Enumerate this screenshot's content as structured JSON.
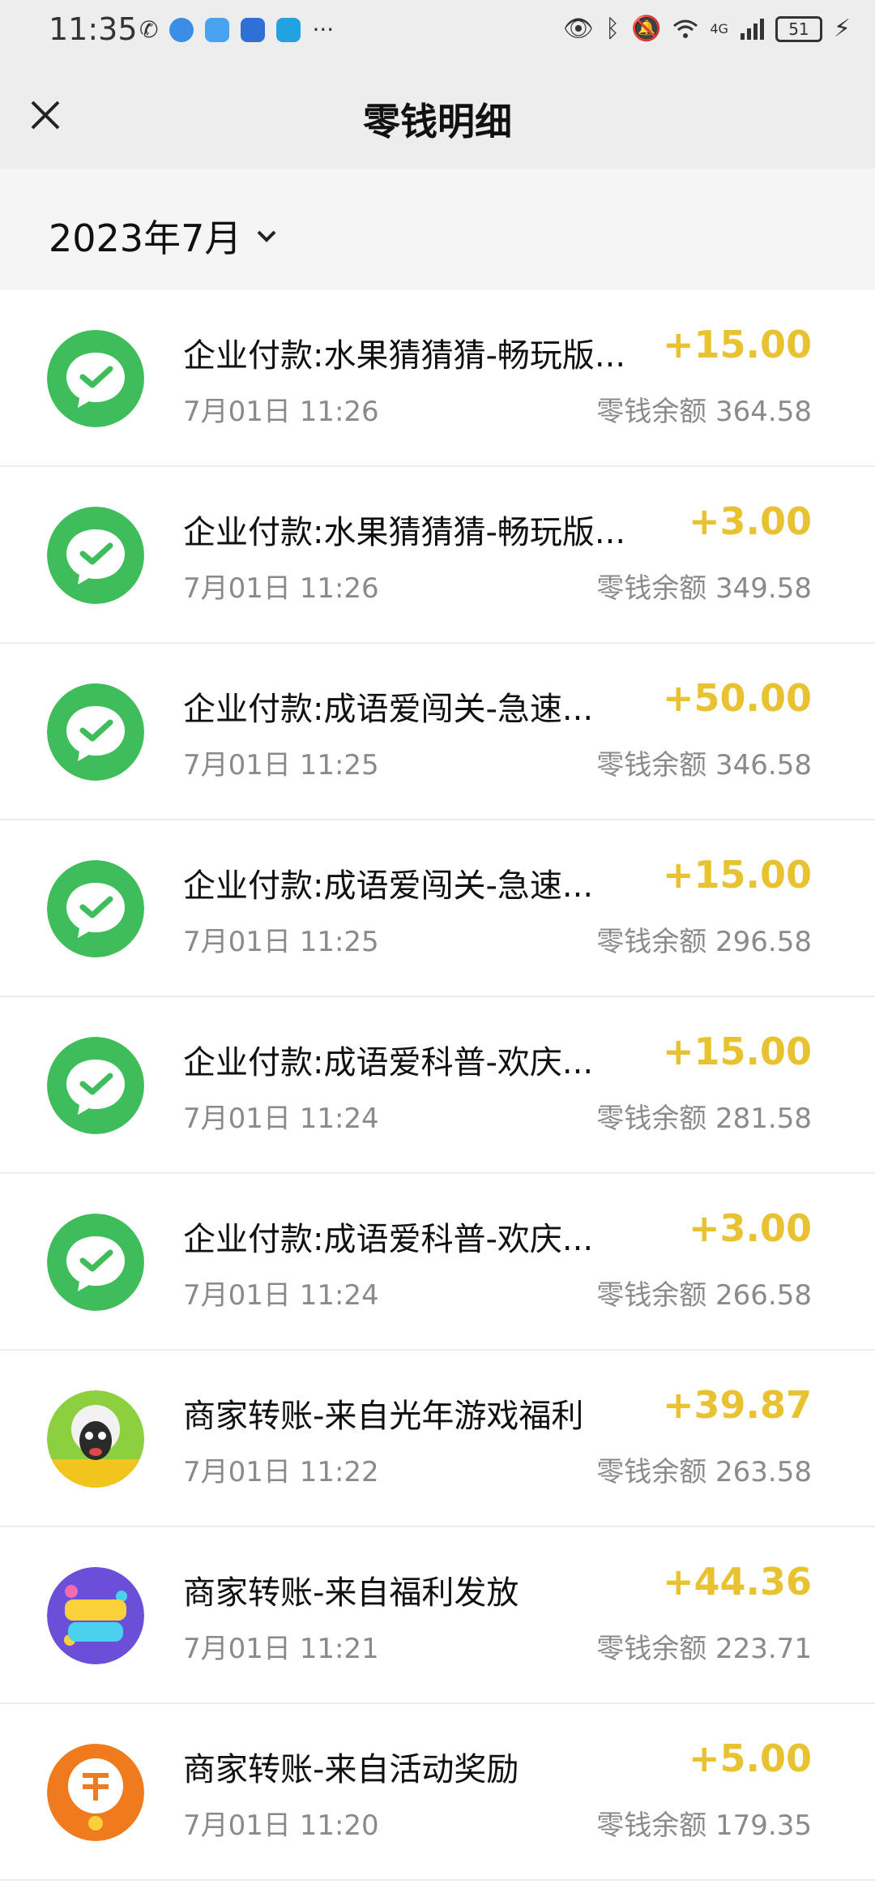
{
  "status": {
    "time": "11:35",
    "battery": "51",
    "network": "4G"
  },
  "header": {
    "title": "零钱明细",
    "close_icon": "close-icon"
  },
  "month": {
    "label": "2023年7月",
    "icon": "chevron-down-icon"
  },
  "balance_label": "零钱余额",
  "colors": {
    "amount": "#e8c230",
    "wechat_green": "#3ebd5a",
    "header_bg": "#ededed"
  },
  "transactions": [
    {
      "title": "企业付款:水果猜猜猜-畅玩版...",
      "time": "7月01日 11:26",
      "amount": "+15.00",
      "balance": "零钱余额 364.58",
      "icon": "wechat-pay-icon"
    },
    {
      "title": "企业付款:水果猜猜猜-畅玩版...",
      "time": "7月01日 11:26",
      "amount": "+3.00",
      "balance": "零钱余额 349.58",
      "icon": "wechat-pay-icon"
    },
    {
      "title": "企业付款:成语爱闯关-急速...",
      "time": "7月01日 11:25",
      "amount": "+50.00",
      "balance": "零钱余额 346.58",
      "icon": "wechat-pay-icon"
    },
    {
      "title": "企业付款:成语爱闯关-急速...",
      "time": "7月01日 11:25",
      "amount": "+15.00",
      "balance": "零钱余额 296.58",
      "icon": "wechat-pay-icon"
    },
    {
      "title": "企业付款:成语爱科普-欢庆...",
      "time": "7月01日 11:24",
      "amount": "+15.00",
      "balance": "零钱余额 281.58",
      "icon": "wechat-pay-icon"
    },
    {
      "title": "企业付款:成语爱科普-欢庆...",
      "time": "7月01日 11:24",
      "amount": "+3.00",
      "balance": "零钱余额 266.58",
      "icon": "wechat-pay-icon"
    },
    {
      "title": "商家转账-来自光年游戏福利",
      "time": "7月01日 11:22",
      "amount": "+39.87",
      "balance": "零钱余额 263.58",
      "icon": "sheep-game-icon"
    },
    {
      "title": "商家转账-来自福利发放",
      "time": "7月01日 11:21",
      "amount": "+44.36",
      "balance": "零钱余额 223.71",
      "icon": "game-2048-icon"
    },
    {
      "title": "商家转账-来自活动奖励",
      "time": "7月01日 11:20",
      "amount": "+5.00",
      "balance": "零钱余额 179.35",
      "icon": "answer-game-icon"
    }
  ]
}
